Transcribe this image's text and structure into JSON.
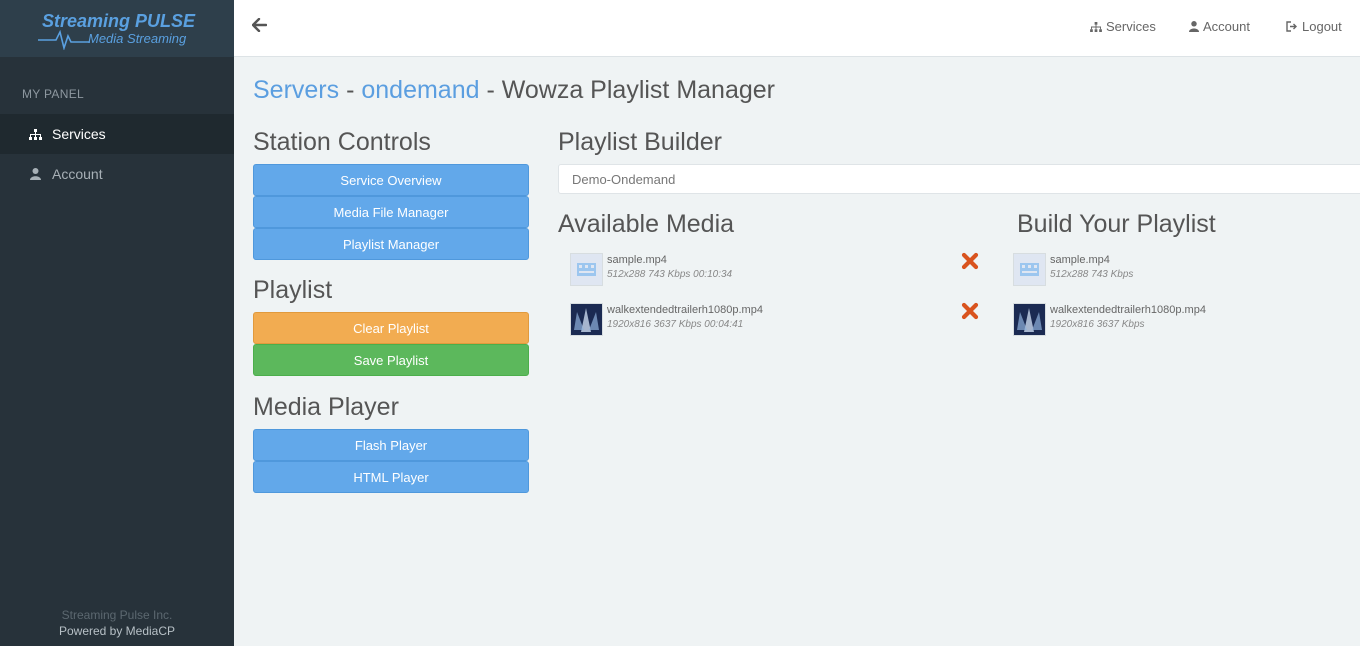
{
  "brand": {
    "line1": "Streaming PULSE",
    "line2": "Media Streaming"
  },
  "sidebar": {
    "panel_title": "MY PANEL",
    "items": [
      {
        "label": "Services",
        "icon": "sitemap-icon",
        "active": true
      },
      {
        "label": "Account",
        "icon": "user-icon",
        "active": false
      }
    ],
    "footer_company": "Streaming Pulse Inc.",
    "footer_powered": "Powered by MediaCP"
  },
  "topbar": {
    "services_label": "Services",
    "account_label": "Account",
    "logout_label": "Logout"
  },
  "breadcrumb": {
    "servers": "Servers",
    "sep1": " - ",
    "service": "ondemand",
    "sep2": " - ",
    "page": "Wowza Playlist Manager"
  },
  "station_controls": {
    "title": "Station Controls",
    "buttons": [
      "Service Overview",
      "Media File Manager",
      "Playlist Manager"
    ]
  },
  "playlist": {
    "title": "Playlist",
    "clear_label": "Clear Playlist",
    "save_label": "Save Playlist"
  },
  "media_player": {
    "title": "Media Player",
    "flash_label": "Flash Player",
    "html_label": "HTML Player"
  },
  "builder": {
    "title": "Playlist Builder",
    "selected_playlist": "Demo-Ondemand",
    "available_title": "Available Media",
    "build_title": "Build Your Playlist"
  },
  "available_media": [
    {
      "name": "sample.mp4",
      "meta": "512x288 743 Kbps 00:10:34"
    },
    {
      "name": "walkextendedtrailerh1080p.mp4",
      "meta": "1920x816 3637 Kbps 00:04:41"
    }
  ],
  "playlist_items": [
    {
      "name": "sample.mp4",
      "meta": "512x288 743 Kbps"
    },
    {
      "name": "walkextendedtrailerh1080p.mp4",
      "meta": "1920x816 3637 Kbps"
    }
  ],
  "colors": {
    "sidebar": "#27323a",
    "accent": "#5b9ee0",
    "blue_button": "#62a8ea",
    "orange_button": "#f2ac51",
    "green_button": "#5cb85c",
    "remove_icon": "#d9531e"
  }
}
